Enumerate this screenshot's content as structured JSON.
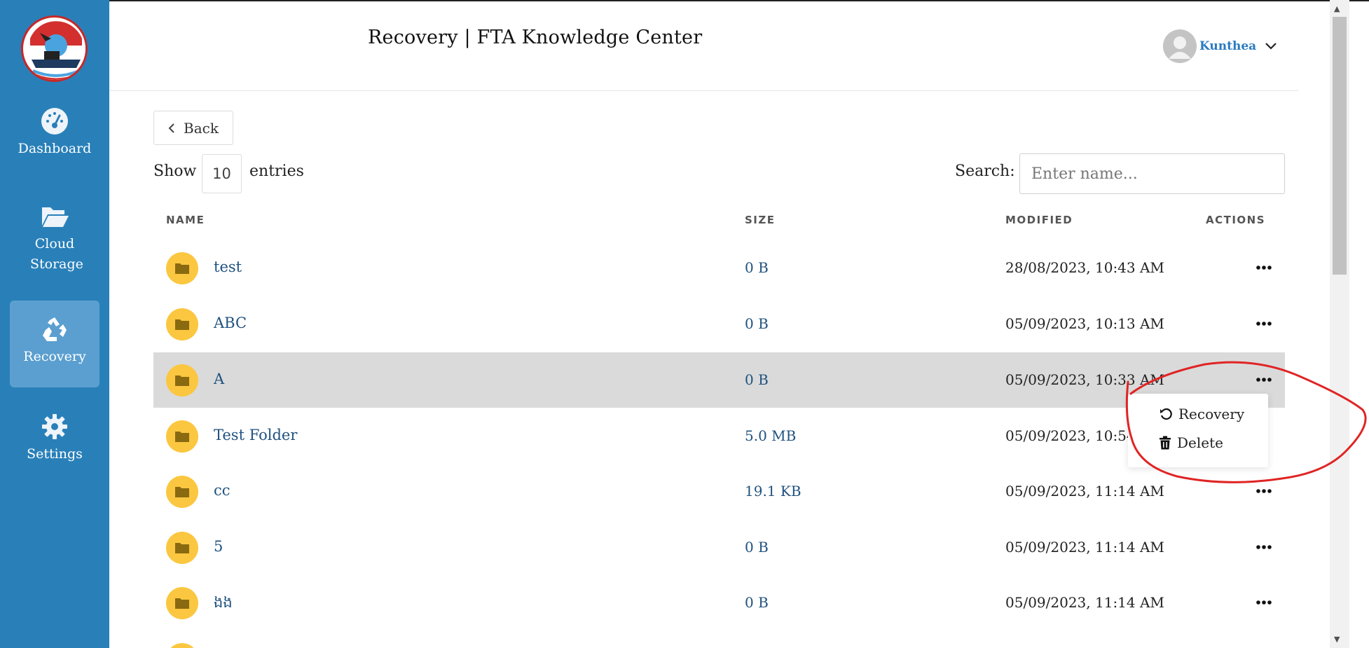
{
  "app": {
    "title": "Recovery | FTA Knowledge Center",
    "accent": "#2980b9",
    "folder_color": "#fbc740"
  },
  "sidebar": {
    "items": [
      {
        "label": "Dashboard",
        "icon": "dashboard-gauge-icon",
        "active": false
      },
      {
        "label": "Cloud Storage",
        "icon": "folder-open-icon",
        "active": false
      },
      {
        "label": "Recovery",
        "icon": "recycle-icon",
        "active": true
      },
      {
        "label": "Settings",
        "icon": "gear-icon",
        "active": false
      }
    ]
  },
  "user": {
    "name": "Kunthea",
    "avatar_icon": "user-avatar-icon"
  },
  "toolbar": {
    "back_label": "Back",
    "show_label": "Show",
    "entries_value": "10",
    "entries_label": "entries",
    "search_label": "Search:",
    "search_placeholder": "Enter name..."
  },
  "table": {
    "columns": [
      "NAME",
      "SIZE",
      "MODIFIED",
      "ACTIONS"
    ],
    "rows": [
      {
        "name": "test",
        "size": "0 B",
        "modified": "28/08/2023, 10:43 AM"
      },
      {
        "name": "ABC",
        "size": "0 B",
        "modified": "05/09/2023, 10:13 AM"
      },
      {
        "name": "A",
        "size": "0 B",
        "modified": "05/09/2023, 10:33 AM"
      },
      {
        "name": "Test Folder",
        "size": "5.0 MB",
        "modified": "05/09/2023, 10:54"
      },
      {
        "name": "cc",
        "size": "19.1 KB",
        "modified": "05/09/2023, 11:14 AM"
      },
      {
        "name": "5",
        "size": "0 B",
        "modified": "05/09/2023, 11:14 AM"
      },
      {
        "name": "ងង",
        "size": "0 B",
        "modified": "05/09/2023, 11:14 AM"
      }
    ],
    "highlighted_row": "A"
  },
  "context_menu": {
    "items": [
      {
        "label": "Recovery",
        "icon": "undo-icon"
      },
      {
        "label": "Delete",
        "icon": "trash-icon"
      }
    ],
    "annotation_color": "#e02424"
  }
}
